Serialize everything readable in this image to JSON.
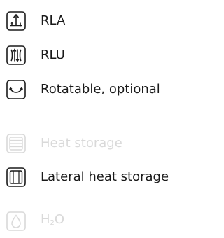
{
  "legend": {
    "items": [
      {
        "label": "RLA",
        "icon": "rla-icon",
        "disabled": false
      },
      {
        "label": "RLU",
        "icon": "rlu-icon",
        "disabled": false
      },
      {
        "label": "Rotatable, optional",
        "icon": "rotatable-icon",
        "disabled": false
      },
      {
        "label": "Heat storage",
        "icon": "heat-storage-icon",
        "disabled": true
      },
      {
        "label": "Lateral heat storage",
        "icon": "lateral-heat-storage-icon",
        "disabled": false
      },
      {
        "label_main": "H",
        "label_sub": "2",
        "label_tail": "O",
        "icon": "water-drop-icon",
        "disabled": true
      }
    ]
  },
  "colors": {
    "active": "#1a1a1a",
    "disabled": "#d9d9d9"
  }
}
